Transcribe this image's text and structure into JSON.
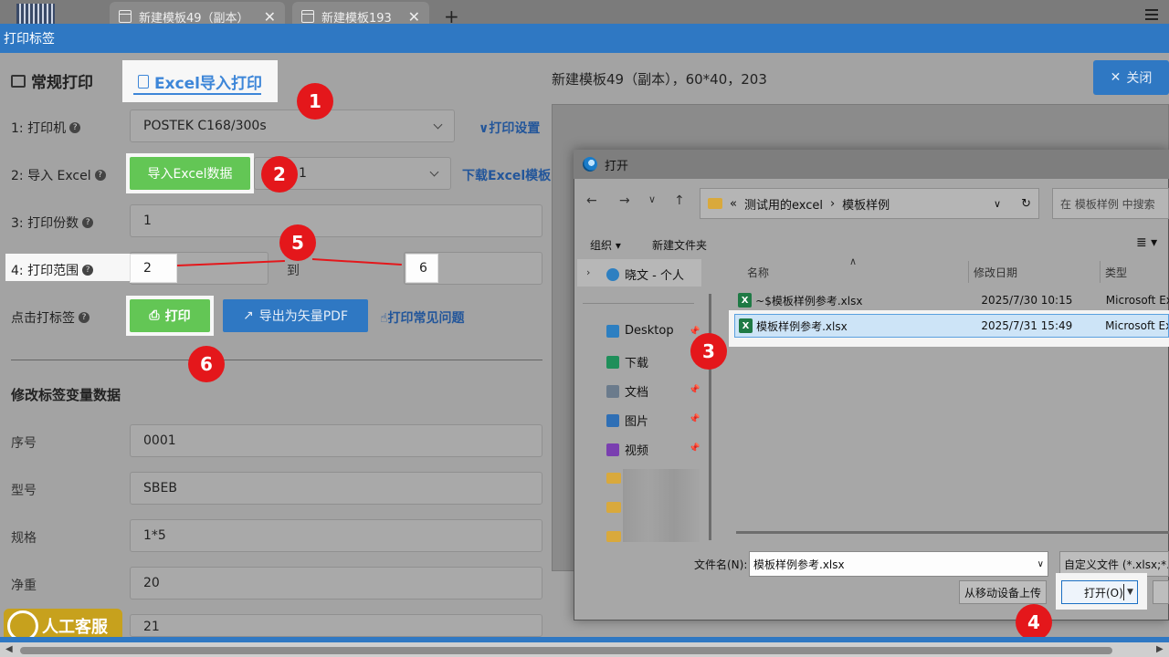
{
  "tabs": [
    {
      "label": "新建模板49（副本）"
    },
    {
      "label": "新建模板193"
    }
  ],
  "tab_add": "+",
  "window_title": "打印标签",
  "modes": {
    "normal": "常规打印",
    "excel": "Excel导入打印"
  },
  "form": {
    "printer_label": "1: 打印机",
    "printer_value": "POSTEK C168/300s",
    "print_settings": "打印设置",
    "import_label": "2: 导入 Excel",
    "import_button": "导入Excel数据",
    "import_select_value": "1",
    "download_template": "下载Excel模板",
    "copies_label": "3: 打印份数",
    "copies_value": "1",
    "range_label": "4: 打印范围",
    "range_from": "2",
    "range_to_label": "到",
    "range_to": "6",
    "click_print_label": "点击打标签",
    "print_button": "打印",
    "export_pdf_button": "导出为矢量PDF",
    "print_faq": "打印常见问题"
  },
  "variables": {
    "title": "修改标签变量数据",
    "fields": [
      {
        "label": "序号",
        "value": "0001"
      },
      {
        "label": "型号",
        "value": "SBEB"
      },
      {
        "label": "规格",
        "value": "1*5"
      },
      {
        "label": "净重",
        "value": "20"
      },
      {
        "label": "",
        "value": "21"
      }
    ]
  },
  "preview_title": "新建模板49（副本），60*40，203",
  "close_button": "关闭",
  "dialog": {
    "title": "打开",
    "breadcrumb_prefix": "«",
    "breadcrumb": [
      "测试用的excel",
      "模板样例"
    ],
    "search_placeholder": "在 模板样例 中搜索",
    "organize": "组织",
    "new_folder": "新建文件夹",
    "nav_top": "晓文 - 个人",
    "nav_items": [
      {
        "label": "Desktop",
        "icon": "desktop-icon",
        "color": "#2d7fc1"
      },
      {
        "label": "下载",
        "icon": "download-icon",
        "color": "#1f8f5a"
      },
      {
        "label": "文档",
        "icon": "document-icon",
        "color": "#6b7b8c"
      },
      {
        "label": "图片",
        "icon": "picture-icon",
        "color": "#2f6fb5"
      },
      {
        "label": "视频",
        "icon": "video-icon",
        "color": "#7a3fb0"
      }
    ],
    "columns": {
      "name": "名称",
      "date": "修改日期",
      "type": "类型"
    },
    "files": [
      {
        "name": "~$模板样例参考.xlsx",
        "date": "2025/7/30 10:15",
        "type": "Microsoft Ex"
      },
      {
        "name": "模板样例参考.xlsx",
        "date": "2025/7/31 15:49",
        "type": "Microsoft Ex"
      }
    ],
    "filename_label": "文件名(N):",
    "filename_value": "模板样例参考.xlsx",
    "filter_value": "自定义文件 (*.xlsx;*.xl",
    "upload_mobile": "从移动设备上传",
    "open_button": "打开(O)"
  },
  "markers": [
    "1",
    "2",
    "3",
    "4",
    "5",
    "6"
  ],
  "support": "人工客服"
}
